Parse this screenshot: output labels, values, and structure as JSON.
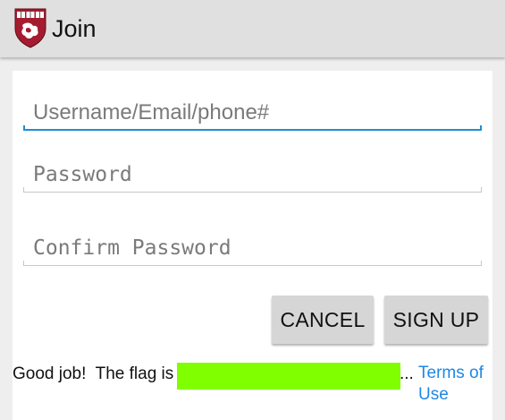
{
  "header": {
    "title": "Join",
    "logo_icon": "harvard-shield-logo",
    "background": "#e0e0e0"
  },
  "form": {
    "username_placeholder": "Username/Email/phone#",
    "username_value": "",
    "password_placeholder": "Password",
    "password_value": "",
    "confirm_placeholder": "Confirm Password",
    "confirm_value": "",
    "accent_color": "#1d8fd3"
  },
  "buttons": {
    "cancel_label": "CANCEL",
    "signup_label": "SIGN UP"
  },
  "footer": {
    "flag_text": "Good job!  The flag is",
    "flag_highlight_color": "#7fff00",
    "ellipsis": "...",
    "terms_label": "Terms of Use",
    "link_color": "#1e88e5"
  }
}
